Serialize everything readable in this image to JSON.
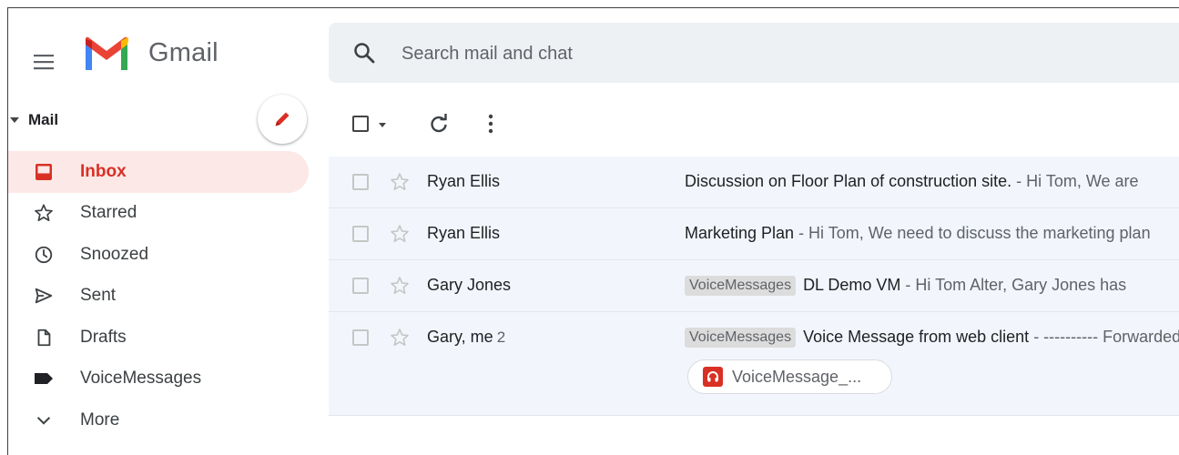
{
  "app": {
    "name": "Gmail"
  },
  "search": {
    "placeholder": "Search mail and chat"
  },
  "sidebar": {
    "section_label": "Mail",
    "items": [
      {
        "label": "Inbox",
        "icon": "inbox-icon",
        "active": true
      },
      {
        "label": "Starred",
        "icon": "star-icon"
      },
      {
        "label": "Snoozed",
        "icon": "clock-icon"
      },
      {
        "label": "Sent",
        "icon": "send-icon"
      },
      {
        "label": "Drafts",
        "icon": "draft-icon"
      },
      {
        "label": "VoiceMessages",
        "icon": "label-icon"
      },
      {
        "label": "More",
        "icon": "chevron-down-icon"
      }
    ]
  },
  "toolbar": {
    "select_icon": "checkbox-icon",
    "refresh_icon": "refresh-icon",
    "more_icon": "more-vert-icon"
  },
  "emails": [
    {
      "sender": "Ryan Ellis",
      "count": "",
      "label": "",
      "subject": "Discussion on Floor Plan of construction site.",
      "snippet": " - Hi Tom, We are"
    },
    {
      "sender": "Ryan Ellis",
      "count": "",
      "label": "",
      "subject": "Marketing Plan",
      "snippet": " - Hi Tom, We need to discuss the marketing plan"
    },
    {
      "sender": "Gary Jones",
      "count": "",
      "label": "VoiceMessages",
      "subject": "DL Demo VM",
      "snippet": " - Hi Tom Alter, Gary Jones has"
    },
    {
      "sender": "Gary, me",
      "count": "2",
      "label": "VoiceMessages",
      "subject": "Voice Message from web client",
      "snippet": " - ---------- Forwarded",
      "attachment": "VoiceMessage_..."
    }
  ],
  "colors": {
    "accent": "#d93025",
    "active_bg": "#fce8e6",
    "row_bg": "#f2f6fc",
    "search_bg": "#eef1f4"
  }
}
